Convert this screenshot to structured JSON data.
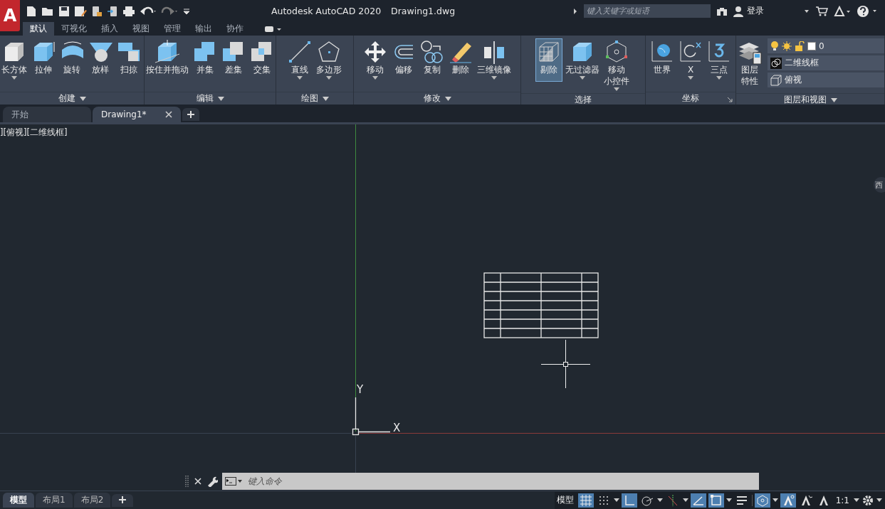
{
  "app_logo": "A",
  "title_bar": {
    "title": "Autodesk AutoCAD 2020",
    "file": "Drawing1.dwg",
    "search": {
      "placeholder": "键入关键字或短语"
    },
    "login": "登录"
  },
  "ribbon_tabs": [
    {
      "label": "默认",
      "selected": true
    },
    {
      "label": "可视化",
      "selected": false
    },
    {
      "label": "插入",
      "selected": false
    },
    {
      "label": "视图",
      "selected": false
    },
    {
      "label": "管理",
      "selected": false
    },
    {
      "label": "输出",
      "selected": false
    },
    {
      "label": "协作",
      "selected": false
    }
  ],
  "panels": [
    {
      "title": "创建",
      "tools": [
        {
          "label": "长方体",
          "dropdown": true,
          "selected": false
        },
        {
          "label": "拉伸",
          "dropdown": false,
          "selected": false
        },
        {
          "label": "旋转",
          "dropdown": false,
          "selected": false
        },
        {
          "label": "放样",
          "dropdown": false,
          "selected": false
        },
        {
          "label": "扫掠",
          "dropdown": false,
          "selected": false
        }
      ]
    },
    {
      "title": "编辑",
      "tools": [
        {
          "label": "按住并拖动",
          "dropdown": false,
          "selected": false
        },
        {
          "label": "并集",
          "dropdown": false,
          "selected": false
        },
        {
          "label": "差集",
          "dropdown": false,
          "selected": false
        },
        {
          "label": "交集",
          "dropdown": false,
          "selected": false
        }
      ]
    },
    {
      "title": "绘图",
      "tools": [
        {
          "label": "直线",
          "dropdown": true,
          "selected": false
        },
        {
          "label": "多边形",
          "dropdown": true,
          "selected": false
        }
      ]
    },
    {
      "title": "修改",
      "tools": [
        {
          "label": "移动",
          "dropdown": true,
          "selected": false
        },
        {
          "label": "偏移",
          "dropdown": false,
          "selected": false
        },
        {
          "label": "复制",
          "dropdown": false,
          "selected": false
        },
        {
          "label": "删除",
          "dropdown": false,
          "selected": false
        },
        {
          "label": "三维镜像",
          "dropdown": true,
          "selected": false
        }
      ]
    },
    {
      "title": "选择",
      "tools": [
        {
          "label": "剔除",
          "dropdown": false,
          "selected": true
        },
        {
          "label": "无过滤器",
          "dropdown": true,
          "selected": false
        },
        {
          "label": "移动",
          "label_line_2": "小控件",
          "dropdown": true,
          "selected": false
        }
      ]
    },
    {
      "title": "坐标",
      "tools": [
        {
          "label": "世界",
          "dropdown": false,
          "selected": false
        },
        {
          "label": "X",
          "dropdown": true,
          "selected": false
        },
        {
          "label": "三点",
          "dropdown": true,
          "selected": false
        }
      ]
    },
    {
      "title": "图层和视图",
      "tools": [
        {
          "label": "图层",
          "label_line_2": "特性",
          "dropdown": false,
          "selected": false
        }
      ],
      "layer": "0",
      "visual_style": "二维线框",
      "view": "俯视"
    }
  ],
  "file_tabs": [
    {
      "label": "开始",
      "selected": false
    },
    {
      "label": "Drawing1*",
      "selected": true
    }
  ],
  "viewport": {
    "label": "][俯视][二维线框]",
    "viewcube_label": "西",
    "axis_x": "X",
    "axis_y": "Y"
  },
  "command_line": {
    "placeholder": "键入命令"
  },
  "layout_tabs": [
    {
      "label": "模型",
      "selected": true
    },
    {
      "label": "布局1",
      "selected": false
    },
    {
      "label": "布局2",
      "selected": false
    }
  ],
  "status_bar": {
    "space": "模型",
    "scale": "1:1",
    "toggles": [
      {
        "on": true
      },
      {
        "on": false
      },
      {
        "on": true
      },
      {
        "on": false
      },
      {
        "on": false
      },
      {
        "on": true
      },
      {
        "on": true
      },
      {
        "on": false
      },
      {
        "on": true
      },
      {
        "on": true
      },
      {
        "on": false
      },
      {
        "on": false
      }
    ]
  }
}
